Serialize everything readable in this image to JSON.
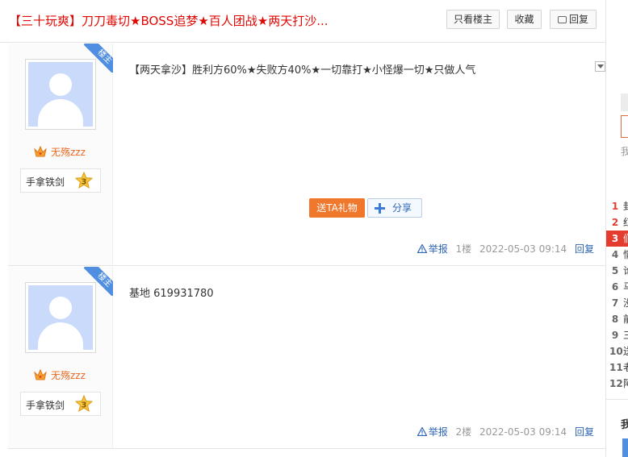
{
  "header": {
    "title": "【三十玩爽】刀刀毒切★BOSS追梦★百人团战★两天打沙...",
    "only_lz_label": "只看楼主",
    "favorite_label": "收藏",
    "reply_label": "回复"
  },
  "posts": [
    {
      "badge": "楼主",
      "username": "无殇zzz",
      "level_name": "手拿铁剑",
      "level": "3",
      "content": "【两天拿沙】胜利方60%★失败方40%★一切靠打★小怪爆一切★只做人气",
      "gift_label": "送TA礼物",
      "share_label": "分享",
      "report_label": "举报",
      "floor": "1楼",
      "time": "2022-05-03 09:14",
      "reply_label": "回复"
    },
    {
      "badge": "楼主",
      "username": "无殇zzz",
      "level_name": "手拿铁剑",
      "level": "3",
      "content": "基地 619931780",
      "report_label": "举报",
      "floor": "2楼",
      "time": "2022-05-03 09:14",
      "reply_label": "回复"
    }
  ],
  "sidebar": {
    "partial_text_1": "我",
    "rank": [
      {
        "num": "1",
        "char": "封"
      },
      {
        "num": "2",
        "char": "红"
      },
      {
        "num": "3",
        "char": "们"
      },
      {
        "num": "4",
        "char": "情"
      },
      {
        "num": "5",
        "char": "论"
      },
      {
        "num": "6",
        "char": "马"
      },
      {
        "num": "7",
        "char": "没"
      },
      {
        "num": "8",
        "char": "前"
      },
      {
        "num": "9",
        "char": "三"
      },
      {
        "num": "10",
        "char": "送"
      },
      {
        "num": "11",
        "char": "老"
      },
      {
        "num": "12",
        "char": "阿"
      }
    ],
    "partial_text_2": "我"
  },
  "colors": {
    "title_red": "#e10602",
    "username_orange": "#e86a21",
    "link_blue": "#2d64b3",
    "gift_orange": "#f0782c",
    "badge_blue": "#4f8ee0",
    "rank_red": "#e43d30"
  }
}
